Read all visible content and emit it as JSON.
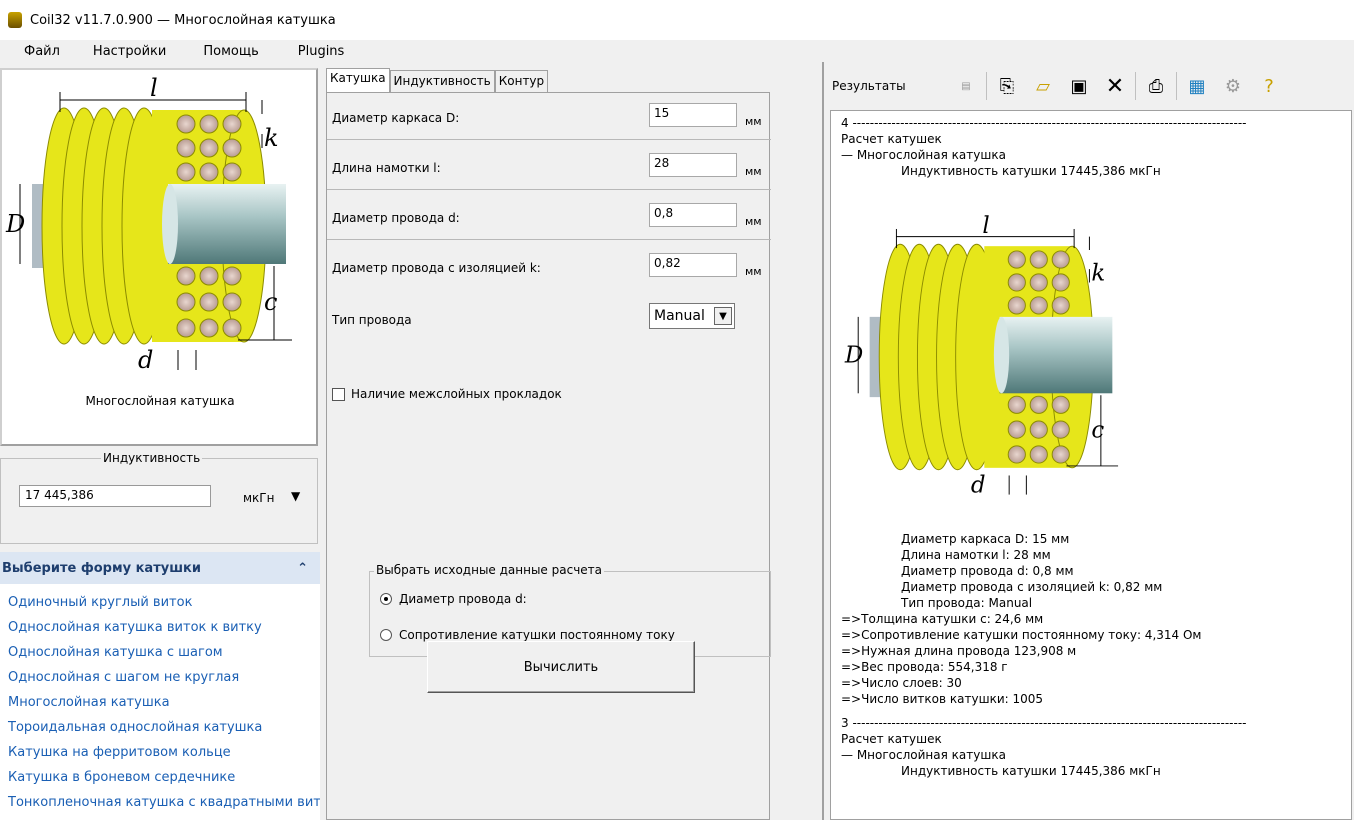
{
  "window": {
    "title": "Coil32 v11.7.0.900 — Многослойная катушка"
  },
  "menu": [
    "Файл",
    "Настройки",
    "Помощь",
    "Plugins"
  ],
  "left": {
    "caption": "Многослойная катушка",
    "inductance_group": {
      "legend": "Индуктивность",
      "value": "17 445,386",
      "unit": "мкГн",
      "arrow": "▼"
    },
    "shape_panel": {
      "header": "Выберите форму катушки",
      "collapse_icon": "⌃",
      "items": [
        "Одиночный круглый виток",
        "Однослойная катушка виток к витку",
        "Однослойная катушка с шагом",
        "Однослойная с шагом не круглая",
        "Многослойная катушка",
        "Тороидальная однослойная катушка",
        "Катушка на ферритовом кольце",
        "Катушка в броневом сердечнике",
        "Тонкопленочная катушка с квадратными вит…"
      ]
    }
  },
  "middle": {
    "tabs": [
      "Катушка",
      "Индуктивность",
      "Контур"
    ],
    "fields": [
      {
        "label": "Диаметр каркаса D:",
        "value": "15",
        "unit": "мм"
      },
      {
        "label": "Длина намотки l:",
        "value": "28",
        "unit": "мм"
      },
      {
        "label": "Диаметр провода d:",
        "value": "0,8",
        "unit": "мм"
      },
      {
        "label": "Диаметр провода с изоляцией k:",
        "value": "0,82",
        "unit": "мм"
      }
    ],
    "wire_type": {
      "label": "Тип провода",
      "value": "Manual"
    },
    "checkbox": "Наличие межслойных прокладок",
    "source_group": {
      "legend": "Выбрать исходные данные расчета",
      "options": [
        "Диаметр провода d:",
        "Сопротивление катушки постоянному току"
      ]
    },
    "calc_button": "Вычислить"
  },
  "right": {
    "toolbar_label": "Результаты",
    "results_top": [
      "4 -------------------------------------------------------------------------------------------",
      "Расчет катушек",
      "— Многослойная катушка"
    ],
    "results_top_ind": "Индуктивность катушки 17445,386 мкГн",
    "params": [
      "Диаметр каркаса D: 15 мм",
      "Длина намотки l: 28 мм",
      "Диаметр провода d: 0,8 мм",
      "Диаметр провода с изоляцией k: 0,82 мм",
      "Тип провода: Manual"
    ],
    "outputs": [
      "=>Толщина катушки c: 24,6 мм",
      "=>Сопротивление катушки постоянному току: 4,314 Ом",
      "=>Нужная длина провода 123,908 м",
      "=>Вес провода: 554,318 г",
      "=>Число слоев: 30",
      "=>Число витков катушки: 1005"
    ],
    "results_bottom": [
      "3 -------------------------------------------------------------------------------------------",
      "Расчет катушек",
      "— Многослойная катушка"
    ],
    "results_bottom_ind": "Индуктивность катушки 17445,386 мкГн"
  },
  "diagram_labels": {
    "l": "l",
    "k": "k",
    "D": "D",
    "c": "c",
    "d": "d"
  }
}
